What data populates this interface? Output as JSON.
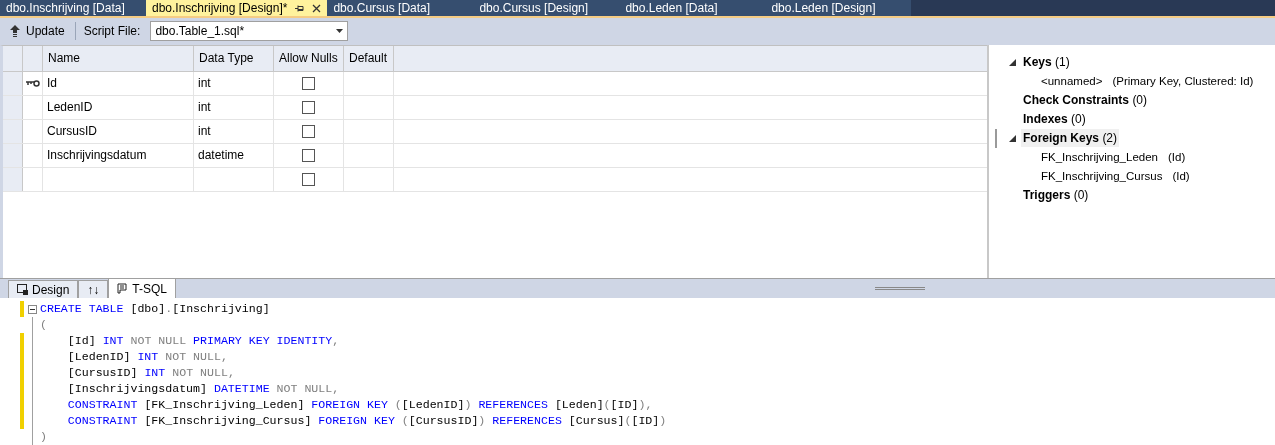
{
  "document_tabs": [
    {
      "label": "dbo.Inschrijving [Data]",
      "selected": false
    },
    {
      "label": "dbo.Inschrijving [Design]*",
      "selected": true
    },
    {
      "label": "dbo.Cursus [Data]",
      "selected": false
    },
    {
      "label": "dbo.Cursus [Design]",
      "selected": false
    },
    {
      "label": "dbo.Leden [Data]",
      "selected": false
    },
    {
      "label": "dbo.Leden [Design]",
      "selected": false
    }
  ],
  "toolbar": {
    "update_label": "Update",
    "script_file_label": "Script File:",
    "script_file_value": "dbo.Table_1.sql*"
  },
  "table": {
    "columns": [
      "Name",
      "Data Type",
      "Allow Nulls",
      "Default"
    ],
    "rows": [
      {
        "name": "Id",
        "data_type": "int",
        "allow_nulls": false,
        "primary_key": true
      },
      {
        "name": "LedenID",
        "data_type": "int",
        "allow_nulls": false,
        "primary_key": false
      },
      {
        "name": "CursusID",
        "data_type": "int",
        "allow_nulls": false,
        "primary_key": false
      },
      {
        "name": "Inschrijvingsdatum",
        "data_type": "datetime",
        "allow_nulls": false,
        "primary_key": false
      },
      {
        "allow_nulls": false,
        "primary_key": false
      }
    ]
  },
  "properties": [
    {
      "label": "Keys",
      "count": "(1)",
      "expanded": true,
      "selected": false,
      "children": [
        {
          "name": "<unnamed>",
          "detail": "(Primary Key, Clustered: Id)"
        }
      ]
    },
    {
      "label": "Check Constraints",
      "count": "(0)",
      "selected": false
    },
    {
      "label": "Indexes",
      "count": "(0)",
      "selected": false
    },
    {
      "label": "Foreign Keys",
      "count": "(2)",
      "expanded": true,
      "selected": true,
      "children": [
        {
          "name": "FK_Inschrijving_Leden",
          "detail": "(Id)"
        },
        {
          "name": "FK_Inschrijving_Cursus",
          "detail": "(Id)"
        }
      ]
    },
    {
      "label": "Triggers",
      "count": "(0)",
      "selected": false
    }
  ],
  "view_tabs": [
    {
      "label": "Design",
      "selected": false,
      "kind": "design"
    },
    {
      "label": "↑↓",
      "selected": false,
      "kind": "swap"
    },
    {
      "label": "T-SQL",
      "selected": true,
      "kind": "sql"
    }
  ],
  "code": [
    {
      "changed": true,
      "foldable": true,
      "tokens": [
        {
          "text": "CREATE TABLE ",
          "kind": "kw"
        },
        {
          "text": "[dbo]",
          "kind": "id"
        },
        {
          "text": ".",
          "kind": "op"
        },
        {
          "text": "[Inschrijving]",
          "kind": "id"
        }
      ]
    },
    {
      "changed": false,
      "tokens": [
        {
          "text": "(",
          "kind": "op"
        }
      ]
    },
    {
      "changed": true,
      "tokens": [
        {
          "text": "    [Id] ",
          "kind": "id"
        },
        {
          "text": "INT ",
          "kind": "kw"
        },
        {
          "text": "NOT NULL ",
          "kind": "op"
        },
        {
          "text": "PRIMARY KEY IDENTITY",
          "kind": "kw"
        },
        {
          "text": ",",
          "kind": "op"
        }
      ]
    },
    {
      "changed": true,
      "tokens": [
        {
          "text": "    [LedenID] ",
          "kind": "id"
        },
        {
          "text": "INT ",
          "kind": "kw"
        },
        {
          "text": "NOT NULL,",
          "kind": "op"
        }
      ]
    },
    {
      "changed": true,
      "tokens": [
        {
          "text": "    [CursusID] ",
          "kind": "id"
        },
        {
          "text": "INT ",
          "kind": "kw"
        },
        {
          "text": "NOT NULL,",
          "kind": "op"
        }
      ]
    },
    {
      "changed": true,
      "tokens": [
        {
          "text": "    [Inschrijvingsdatum] ",
          "kind": "id"
        },
        {
          "text": "DATETIME ",
          "kind": "kw"
        },
        {
          "text": "NOT NULL,",
          "kind": "op"
        }
      ]
    },
    {
      "changed": true,
      "tokens": [
        {
          "text": "    CONSTRAINT ",
          "kind": "kw"
        },
        {
          "text": "[FK_Inschrijving_Leden] ",
          "kind": "id"
        },
        {
          "text": "FOREIGN KEY ",
          "kind": "kw"
        },
        {
          "text": "(",
          "kind": "op"
        },
        {
          "text": "[LedenID]",
          "kind": "id"
        },
        {
          "text": ") ",
          "kind": "op"
        },
        {
          "text": "REFERENCES ",
          "kind": "kw"
        },
        {
          "text": "[Leden]",
          "kind": "id"
        },
        {
          "text": "(",
          "kind": "op"
        },
        {
          "text": "[ID]",
          "kind": "id"
        },
        {
          "text": "),",
          "kind": "op"
        }
      ]
    },
    {
      "changed": true,
      "tokens": [
        {
          "text": "    CONSTRAINT ",
          "kind": "kw"
        },
        {
          "text": "[FK_Inschrijving_Cursus] ",
          "kind": "id"
        },
        {
          "text": "FOREIGN KEY ",
          "kind": "kw"
        },
        {
          "text": "(",
          "kind": "op"
        },
        {
          "text": "[CursusID]",
          "kind": "id"
        },
        {
          "text": ") ",
          "kind": "op"
        },
        {
          "text": "REFERENCES ",
          "kind": "kw"
        },
        {
          "text": "[Cursus]",
          "kind": "id"
        },
        {
          "text": "(",
          "kind": "op"
        },
        {
          "text": "[ID]",
          "kind": "id"
        },
        {
          "text": ")",
          "kind": "op"
        }
      ]
    },
    {
      "changed": false,
      "tokens": [
        {
          "text": ")",
          "kind": "op"
        }
      ]
    }
  ]
}
